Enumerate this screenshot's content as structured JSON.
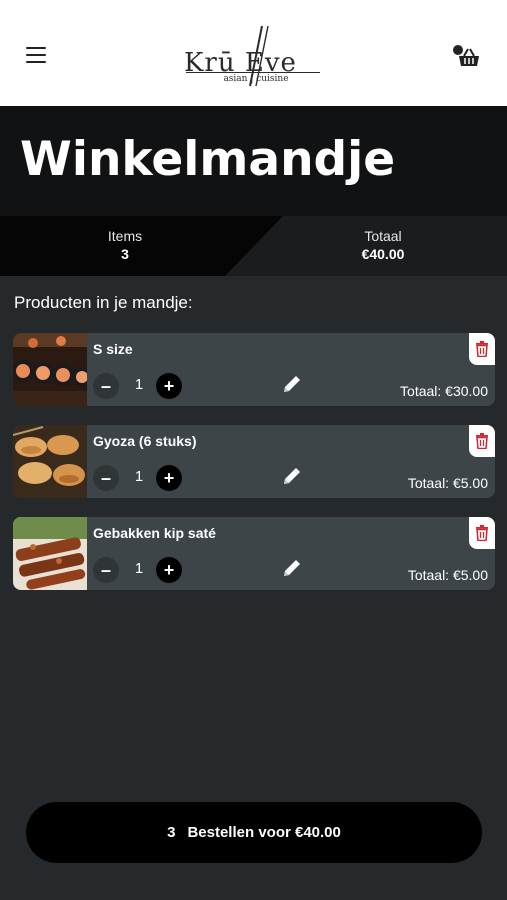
{
  "header": {
    "logo_text": "Krū Eve",
    "logo_subtitle": "asian | cuisine"
  },
  "page": {
    "title": "Winkelmandje"
  },
  "summary": {
    "items_label": "Items",
    "items_value": "3",
    "total_label": "Totaal",
    "total_value": "€40.00"
  },
  "cart": {
    "section_label": "Producten in je mandje:",
    "products": [
      {
        "name": "S size",
        "quantity": "1",
        "total": "Totaal: €30.00",
        "image": "sushi-rolls"
      },
      {
        "name": "Gyoza (6 stuks)",
        "quantity": "1",
        "total": "Totaal: €5.00",
        "image": "gyoza"
      },
      {
        "name": "Gebakken kip saté",
        "quantity": "1",
        "total": "Totaal: €5.00",
        "image": "chicken-skewers"
      }
    ]
  },
  "order": {
    "count": "3",
    "label": "Bestellen voor €40.00"
  },
  "colors": {
    "background": "#26292b",
    "card": "#3e4549",
    "delete_red": "#d9232e"
  }
}
